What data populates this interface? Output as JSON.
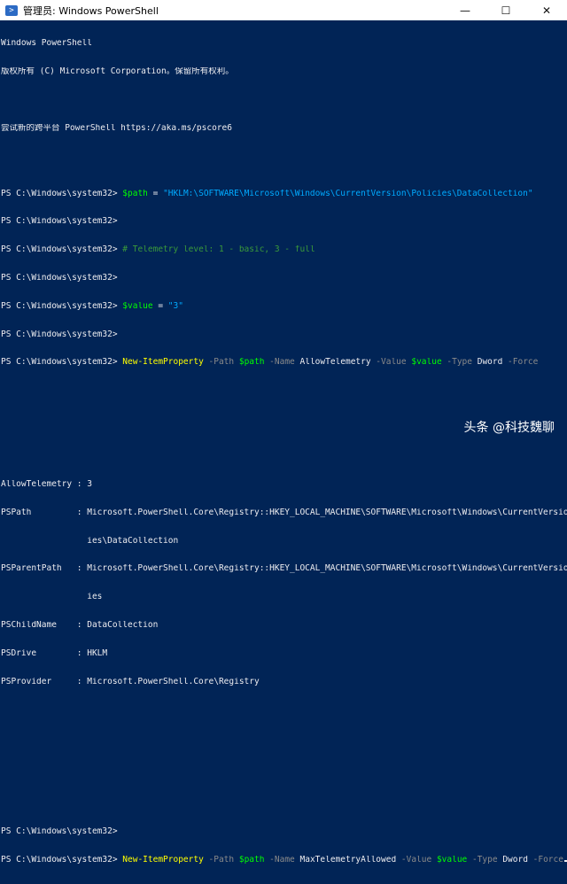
{
  "window": {
    "title": "管理员: Windows PowerShell",
    "minimize": "—",
    "maximize": "☐",
    "close": "✕"
  },
  "console": {
    "header1": "Windows PowerShell",
    "header2": "版权所有 (C) Microsoft Corporation。保留所有权利。",
    "header3": "尝试新的跨平台 PowerShell https://aka.ms/pscore6",
    "prompt": "PS C:\\Windows\\system32> ",
    "cmd1": {
      "var": "$path",
      "eq": " = ",
      "str": "\"HKLM:\\SOFTWARE\\Microsoft\\Windows\\CurrentVersion\\Policies\\DataCollection\""
    },
    "comment": "# Telemetry level: 1 - basic, 3 - full",
    "cmd2": {
      "var": "$value",
      "eq": " = ",
      "str": "\"3\""
    },
    "cmd3": {
      "cmdlet": "New-ItemProperty",
      "p_path": " -Path ",
      "v_path": "$path",
      "p_name": " -Name ",
      "name": "AllowTelemetry",
      "p_value": " -Value ",
      "v_value": "$value",
      "p_type": " -Type ",
      "type": "Dword",
      "p_force": " -Force"
    },
    "output": [
      "AllowTelemetry : 3",
      "PSPath         : Microsoft.PowerShell.Core\\Registry::HKEY_LOCAL_MACHINE\\SOFTWARE\\Microsoft\\Windows\\CurrentVersion\\Polic",
      "                 ies\\DataCollection",
      "PSParentPath   : Microsoft.PowerShell.Core\\Registry::HKEY_LOCAL_MACHINE\\SOFTWARE\\Microsoft\\Windows\\CurrentVersion\\Polic",
      "                 ies",
      "PSChildName    : DataCollection",
      "PSDrive        : HKLM",
      "PSProvider     : Microsoft.PowerShell.Core\\Registry"
    ],
    "cmd4": {
      "cmdlet": "New-ItemProperty",
      "p_path": " -Path ",
      "v_path": "$path",
      "p_name": " -Name ",
      "name": "MaxTelemetryAllowed",
      "p_value": " -Value ",
      "v_value": "$value",
      "p_type": " -Type ",
      "type": "Dword",
      "p_force": " -Force"
    }
  },
  "watermark": "头条 @科技魏聊",
  "colors": {
    "background": "#012456",
    "text": "#eeedf0",
    "cmdlet": "#ffff00",
    "variable": "#00ff00",
    "string": "#00aaff",
    "parameter": "#8a8a8a",
    "comment": "#3a9a3a"
  }
}
